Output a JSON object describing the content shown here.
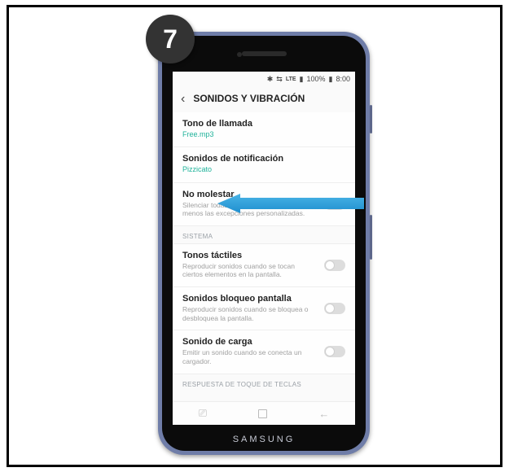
{
  "step_number": "7",
  "phone_brand": "SAMSUNG",
  "status_bar": {
    "bluetooth": "✱",
    "wifi": "⇆",
    "lte": "LTE",
    "signal": "▮",
    "battery_pct": "100%",
    "battery_icon": "▮",
    "time": "8:00"
  },
  "header": {
    "back_glyph": "‹",
    "title": "SONIDOS Y VIBRACIÓN"
  },
  "rows": {
    "ringtone": {
      "title": "Tono de llamada",
      "value": "Free.mp3"
    },
    "notification_sound": {
      "title": "Sonidos de notificación",
      "value": "Pizzicato"
    },
    "dnd": {
      "title": "No molestar",
      "sub": "Silenciar todas las llamadas y alertas, menos las excepciones personalizadas."
    },
    "system_section": "SISTEMA",
    "touch_sounds": {
      "title": "Tonos táctiles",
      "sub": "Reproducir sonidos cuando se tocan ciertos elementos en la pantalla."
    },
    "screen_lock": {
      "title": "Sonidos bloqueo pantalla",
      "sub": "Reproducir sonidos cuando se bloquea o desbloquea la pantalla."
    },
    "charging": {
      "title": "Sonido de carga",
      "sub": "Emitir un sonido cuando se conecta un cargador."
    },
    "keypad_section": "RESPUESTA DE TOQUE DE TECLAS"
  },
  "navbar": {
    "recents": "⎚",
    "home": "□",
    "back": "←"
  }
}
